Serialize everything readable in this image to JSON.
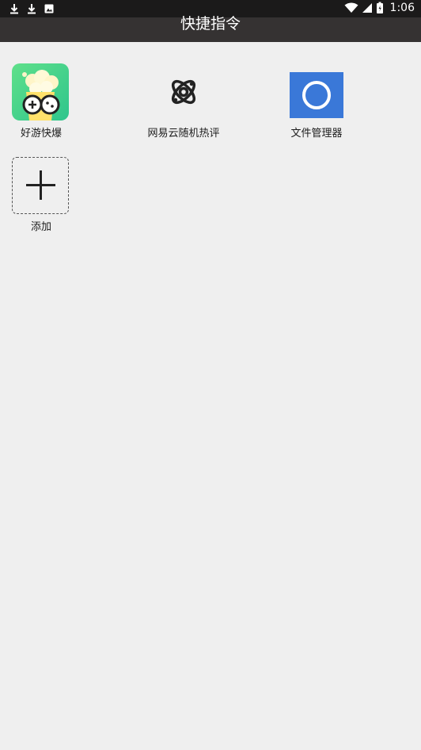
{
  "status_bar": {
    "time": "1:06",
    "left_icons": [
      "download-icon",
      "download-icon",
      "photo-icon"
    ],
    "right_icons": [
      "wifi-icon",
      "signal-icon",
      "battery-icon"
    ]
  },
  "app_bar": {
    "title": "快捷指令"
  },
  "shortcuts": [
    {
      "label": "好游快爆",
      "icon": "haoyou-app-icon"
    },
    {
      "label": "网易云随机热评",
      "icon": "atom-icon"
    },
    {
      "label": "文件管理器",
      "icon": "file-manager-icon"
    },
    {
      "label": "添加",
      "icon": "plus-icon"
    }
  ],
  "colors": {
    "status_bar_bg": "#1b1a1a",
    "app_bar_bg": "#353232",
    "page_bg": "#efefef",
    "file_manager_blue": "#3a78d8",
    "haoyou_green": "#3fd18a"
  }
}
